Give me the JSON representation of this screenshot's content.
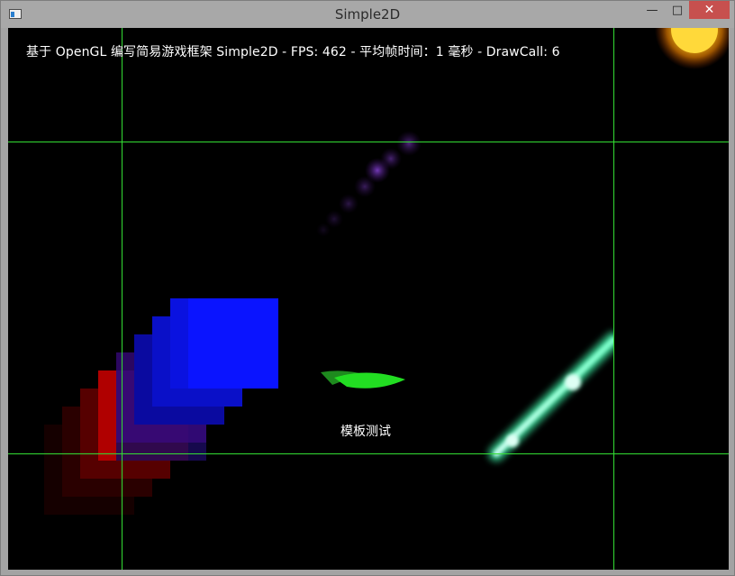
{
  "window": {
    "title": "Simple2D",
    "icon": "app-window-icon",
    "controls": {
      "minimize_glyph": "—",
      "maximize_glyph": "□",
      "close_glyph": "✕"
    }
  },
  "scene": {
    "hud_text": "基于 OpenGL 编写简易游戏框架 Simple2D - FPS: 462 - 平均帧时间：1 毫秒 - DrawCall: 6",
    "stencil_label": "模板测试",
    "colors": {
      "background": "#000000",
      "guide_lines": "#33dd33",
      "blue_square": "#0a14ff",
      "red_square": "#b00000",
      "green_leaf": "#22dd22",
      "cyan_beam": "#88ffcc",
      "sun": "#ffcc22",
      "purple_particles": "#8a2be2"
    }
  }
}
